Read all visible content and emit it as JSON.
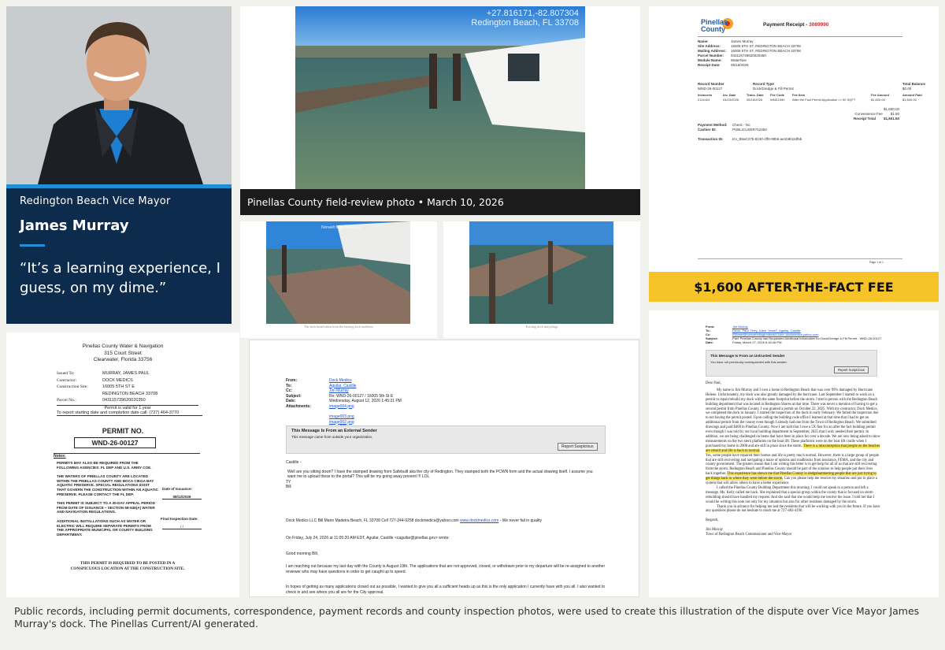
{
  "profile": {
    "role": "Redington Beach Vice Mayor",
    "name": "James Murray",
    "quote": "“It’s a learning experience, I guess, on my dime.”"
  },
  "main_photo": {
    "gps_line1": "+27.816171,-82.807304",
    "gps_line2": "Redington Beach, FL 33708",
    "caption": "Pinellas County field-review photo • March 10, 2026"
  },
  "photo2": {
    "overlay": "Norwelt Map Beach FL",
    "caption": "The dock board taken from the existing dock northeast"
  },
  "photo3": {
    "caption": "Existing dock and pilings"
  },
  "receipt": {
    "county_line1": "Pinellas",
    "county_line2": "County",
    "title": "Payment Receipt - ",
    "number": "3089990",
    "fields": [
      [
        "Name:",
        "James Murray"
      ],
      [
        "Site Address:",
        "16005 5TH ST, REDINGTON BEACH 33708"
      ],
      [
        "Mailing Address:",
        "16005 5TH ST, REDINGTON BEACH 33708"
      ],
      [
        "Parcel Number:",
        "043115739620020350"
      ],
      [
        "Module Name:",
        "WaterNav"
      ],
      [
        "Receipt Date:",
        "05/18/2026"
      ]
    ],
    "record_headers": [
      "Record Number",
      "Record Type",
      "Total Balance"
    ],
    "record_row": [
      "WND-26-00127",
      "Dock/Dredge & Fill Permit",
      "$0.00"
    ],
    "fee_headers": [
      "Invoice#s",
      "Inv. Date",
      "Trans. Date",
      "Fee Code",
      "Fee Item",
      "Fee Amount",
      "Amount Paid"
    ],
    "fee_row": [
      "2114424",
      "04/23/2026",
      "05/18/2026",
      "WND1590",
      "After the Fact Permit Application >= 90 SQFT",
      "$1,600.00",
      "$1,600.00"
    ],
    "totals": [
      [
        "",
        "$1,600.00"
      ],
      [
        "Convenience Fee",
        "$1.50"
      ],
      [
        "Receipt Total",
        "$1,601.50"
      ]
    ],
    "payment": [
      [
        "Payment Method:",
        "Check - No"
      ],
      [
        "Cashier ID:",
        "PUBLICUSER712450"
      ],
      [
        "Transaction ID:",
        "tcn_B5aC27b-8130-4ff6-99b5-ae1b9f42df5b"
      ]
    ],
    "page": "Page 1 of 1",
    "banner": "$1,600 AFTER-THE-FACT FEE"
  },
  "permit": {
    "header1": "Pinellas County Water & Navigation",
    "header2": "315 Court Street",
    "header3": "Clearwater, Florida 33756",
    "fields": [
      [
        "Issued To:",
        "MURRAY, JAMES PAUL"
      ],
      [
        "Contractor:",
        "DOCK MEDICS"
      ],
      [
        "Construction Site:",
        "16005 5TH ST E"
      ],
      [
        "",
        "REDINGTON BEACH 33708"
      ],
      [
        "Parcel No.:",
        "043115739620020350"
      ]
    ],
    "valid": "Permit is valid for 1 year",
    "report": "To report starting date and completion date call: (727) 464-3770",
    "permit_label": "PERMIT NO.",
    "permit_no": "WND-26-00127",
    "notes_label": "Notes:",
    "notes": [
      "PERMITS MAY ALSO BE REQUIRED FROM THE FOLLOWING AGENCIES: FL DEP AND U.S. ARMY COE.",
      "THE WATERS OF PINELLAS COUNTY ARE LOCATED WITHIN THE PINELLAS COUNTY AND BOCA CIEGA BAY AQUATIC PRESERVE. SPECIAL REGULATIONS EXIST THAT GOVERN THE CONSTRUCTION WITHIN AN AQUATIC PRESERVE. PLEASE CONTACT THE FL DEP.",
      "THIS PERMIT IS SUBJECT TO A 30-DAY APPEAL PERIOD FROM DATE OF ISSUANCE – SECTION 58-536(A) WATER AND NAVIGATION REGULATIONS.",
      "ADDITIONAL INSTALLATIONS SUCH AS WATER OR ELECTRIC WILL REQUIRE SEPARATE PERMITS FROM THE APPROPRIATE MUNICIPAL OR COUNTY BUILDING DEPARTMENT."
    ],
    "issuance_label": "Date of Issuance:",
    "issuance_date": "08/12/2026",
    "final_label": "Final Inspection Date:",
    "final_date": "/ /",
    "posting": "THIS PERMIT IS REQUIRED TO BE POSTED IN A CONSPICUOUS LOCATION AT THE CONSTRUCTION SITE."
  },
  "email1": {
    "headers": [
      [
        "From:",
        "Dock Medics"
      ],
      [
        "To:",
        "Aguilar, Castille"
      ],
      [
        "Cc:",
        "Jim Murray"
      ],
      [
        "Subject:",
        "Re: WND-26-00127 / 16005 5th St E"
      ],
      [
        "Date:",
        "Wednesday, August 12, 2026 1:45:31 PM"
      ],
      [
        "Attachments:",
        "image004.png"
      ]
    ],
    "attachments_more": [
      "image003.png",
      "image002.png",
      "image005.png"
    ],
    "banner_title": "This Message Is From an External Sender",
    "banner_sub": "This message came from outside your organization.",
    "report_btn": "Report Suspicious",
    "greeting": "Castille -",
    "body1": "Well are you sitting down? I have the stamped drawing from Safebuilt aka the city of Redington. They stamped both the PCWN form and the actual drawing itself. I assume you want me to upload these to the portal? This will be my going away present !!! LOL",
    "ty": "TY",
    "sig": "Bill",
    "company": "Dock Medics LLC Bill Mann Madeira Beach, FL 33708 Cell 727-244-9258 dockmedics@yahoo.com",
    "company_link": "www.dockmedics.com",
    "company_tail": " - We never fail in quality",
    "quoted": "On Friday, July 24, 2026 at 11:05:20 AM EDT, Aguilar, Castille <caguilar@pinellas.gov> wrote:",
    "good_morning": "Good morning Bill,",
    "para1": "I am reaching out because my last day with the County is August 19th. The applications that are not approved, closed, or withdrawn prior to my departure will be re-assigned to another reviewer who may have questions in order to get caught up to speed.",
    "para2": "In hopes of getting as many applications closed out as possible, I wanted to give you all a sufficient heads up as this is the only application I currently have with you all. I also wanted to check in and see where you all are for the City approval."
  },
  "email2": {
    "headers": [
      [
        "From:",
        "Jim Murray"
      ],
      [
        "To:",
        "Dixon, Paul; Terry, Julee \"Jewel\"; Aguilar, Castille"
      ],
      [
        "Cc:",
        "BStreet@townofredingtonbeach.com; dockmedics.yahoo.com"
      ],
      [
        "Subject:",
        "Fwd: Pinellas County has Requested Additional Information for Dock/Dredge & Fill Permit - WND-26-00127"
      ],
      [
        "Date:",
        "Friday, March 27, 2026 6:16:46 PM"
      ]
    ],
    "banner_title": "This Message Is From an Untrusted Sender",
    "banner_sub": "You have not previously corresponded with this sender.",
    "report_btn": "Report Suspicious",
    "salutation": "Dear Paul,",
    "para_a": "My name is Jim Murray and I own a home in Redington Beach that was over 99% damaged by Hurricane Helene. Unfortunately, my dock was also greatly damaged by the hurricane. Last September I started to work on a permit to repair/rebuild my dock with the same footprint before the storm. I met in person with the Redington Beach building department that was located in Redington Shores at that time. There was never a mention of having to get a second permit from Pinellas County. I was granted a permit on October 22, 2025. With my contractor, Dock Medics, we completed the dock in January. I started the inspection of the dock in early February. We failed the inspection due to not having the permit posted. Upon calling the building code office I learned at that time that I had to get an additional permit from the county even though I already had one from the Town of Redington Beach. We submitted drawings and paid $400 to Pinellas County. Now I am told that I owe a 5X fine for an after the fact building permit even though I was told by our local building department in September, 2025 that I only needed their permit. In addition, we are being challenged on items that have been in place for over a decade. We are now being asked to show measurements on the two stern platforms on the boat lift. These platforms were on the boat lift cradle when I purchased my home in 2008 and are still in place since the storm.",
    "para_a_hl": "There is a misconception that people on the beaches are rebuilt and life is back to normal.",
    "para_b": "Yes, some people have repaired their homes and life is pretty much normal. However, there is a large group of people that are still recovering and navigating a maze of options and roadblocks from insurance, FEMA, and the city and county government. The greater reason that I am writing this letter is to get help for all of us that are still recovering from the storm. Redington Beach and Pinellas County should be part of the solution to help people put their lives back together.",
    "para_b_hl": "This experience has shown me that Pinellas County is sledgehammering people that are just trying to get things back to where they were before the storm.",
    "para_b_tail": "Can you please help me resolve my situation and put in place a system that will allow others to have a better experience.",
    "para_c": "I called the Pinellas County Building Department this morning. I could not speak to a person and left a message. Ms. Kelly called me back. She explained that a special group within the county that is focused on storm rebuilding should have handled my request. And she said that she would help me resolve the issue. I told her that I would be writing this note not only for my situation but also for other residents damaged by the storm.",
    "para_d": "Thank you in advance for helping me and the residents that will be working with you in the future. If you have any questions please do not hesitate to reach me at 727-482-4196.",
    "closing": "Regards,",
    "sig1": "Jim Murray",
    "sig2": "Town of Redington Beach Commissioner and Vice-Mayor"
  },
  "footer": {
    "text": "Public records, including permit documents, correspondence, payment records and county inspection photos, were used to create this illustration of the dispute over Vice Mayor James Murray's dock. The Pinellas Current/AI generated."
  },
  "colors": {
    "navy": "#0d2c4d",
    "accent_blue": "#1f8fd6",
    "banner_yellow": "#f6c428",
    "highlight": "#fbe65b",
    "receipt_red": "#d6262a"
  }
}
